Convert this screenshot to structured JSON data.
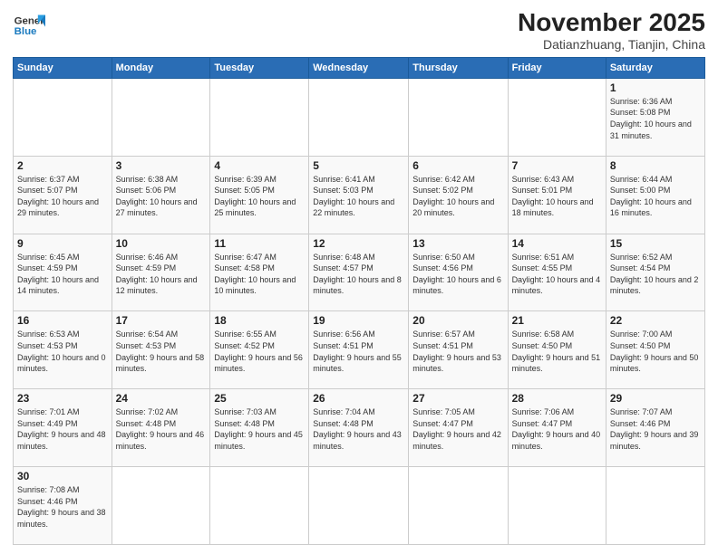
{
  "logo": {
    "line1": "General",
    "line2": "Blue"
  },
  "title": "November 2025",
  "subtitle": "Datianzhuang, Tianjin, China",
  "days_of_week": [
    "Sunday",
    "Monday",
    "Tuesday",
    "Wednesday",
    "Thursday",
    "Friday",
    "Saturday"
  ],
  "weeks": [
    [
      {
        "day": "",
        "info": ""
      },
      {
        "day": "",
        "info": ""
      },
      {
        "day": "",
        "info": ""
      },
      {
        "day": "",
        "info": ""
      },
      {
        "day": "",
        "info": ""
      },
      {
        "day": "",
        "info": ""
      },
      {
        "day": "1",
        "info": "Sunrise: 6:36 AM\nSunset: 5:08 PM\nDaylight: 10 hours and 31 minutes."
      }
    ],
    [
      {
        "day": "2",
        "info": "Sunrise: 6:37 AM\nSunset: 5:07 PM\nDaylight: 10 hours and 29 minutes."
      },
      {
        "day": "3",
        "info": "Sunrise: 6:38 AM\nSunset: 5:06 PM\nDaylight: 10 hours and 27 minutes."
      },
      {
        "day": "4",
        "info": "Sunrise: 6:39 AM\nSunset: 5:05 PM\nDaylight: 10 hours and 25 minutes."
      },
      {
        "day": "5",
        "info": "Sunrise: 6:41 AM\nSunset: 5:03 PM\nDaylight: 10 hours and 22 minutes."
      },
      {
        "day": "6",
        "info": "Sunrise: 6:42 AM\nSunset: 5:02 PM\nDaylight: 10 hours and 20 minutes."
      },
      {
        "day": "7",
        "info": "Sunrise: 6:43 AM\nSunset: 5:01 PM\nDaylight: 10 hours and 18 minutes."
      },
      {
        "day": "8",
        "info": "Sunrise: 6:44 AM\nSunset: 5:00 PM\nDaylight: 10 hours and 16 minutes."
      }
    ],
    [
      {
        "day": "9",
        "info": "Sunrise: 6:45 AM\nSunset: 4:59 PM\nDaylight: 10 hours and 14 minutes."
      },
      {
        "day": "10",
        "info": "Sunrise: 6:46 AM\nSunset: 4:59 PM\nDaylight: 10 hours and 12 minutes."
      },
      {
        "day": "11",
        "info": "Sunrise: 6:47 AM\nSunset: 4:58 PM\nDaylight: 10 hours and 10 minutes."
      },
      {
        "day": "12",
        "info": "Sunrise: 6:48 AM\nSunset: 4:57 PM\nDaylight: 10 hours and 8 minutes."
      },
      {
        "day": "13",
        "info": "Sunrise: 6:50 AM\nSunset: 4:56 PM\nDaylight: 10 hours and 6 minutes."
      },
      {
        "day": "14",
        "info": "Sunrise: 6:51 AM\nSunset: 4:55 PM\nDaylight: 10 hours and 4 minutes."
      },
      {
        "day": "15",
        "info": "Sunrise: 6:52 AM\nSunset: 4:54 PM\nDaylight: 10 hours and 2 minutes."
      }
    ],
    [
      {
        "day": "16",
        "info": "Sunrise: 6:53 AM\nSunset: 4:53 PM\nDaylight: 10 hours and 0 minutes."
      },
      {
        "day": "17",
        "info": "Sunrise: 6:54 AM\nSunset: 4:53 PM\nDaylight: 9 hours and 58 minutes."
      },
      {
        "day": "18",
        "info": "Sunrise: 6:55 AM\nSunset: 4:52 PM\nDaylight: 9 hours and 56 minutes."
      },
      {
        "day": "19",
        "info": "Sunrise: 6:56 AM\nSunset: 4:51 PM\nDaylight: 9 hours and 55 minutes."
      },
      {
        "day": "20",
        "info": "Sunrise: 6:57 AM\nSunset: 4:51 PM\nDaylight: 9 hours and 53 minutes."
      },
      {
        "day": "21",
        "info": "Sunrise: 6:58 AM\nSunset: 4:50 PM\nDaylight: 9 hours and 51 minutes."
      },
      {
        "day": "22",
        "info": "Sunrise: 7:00 AM\nSunset: 4:50 PM\nDaylight: 9 hours and 50 minutes."
      }
    ],
    [
      {
        "day": "23",
        "info": "Sunrise: 7:01 AM\nSunset: 4:49 PM\nDaylight: 9 hours and 48 minutes."
      },
      {
        "day": "24",
        "info": "Sunrise: 7:02 AM\nSunset: 4:48 PM\nDaylight: 9 hours and 46 minutes."
      },
      {
        "day": "25",
        "info": "Sunrise: 7:03 AM\nSunset: 4:48 PM\nDaylight: 9 hours and 45 minutes."
      },
      {
        "day": "26",
        "info": "Sunrise: 7:04 AM\nSunset: 4:48 PM\nDaylight: 9 hours and 43 minutes."
      },
      {
        "day": "27",
        "info": "Sunrise: 7:05 AM\nSunset: 4:47 PM\nDaylight: 9 hours and 42 minutes."
      },
      {
        "day": "28",
        "info": "Sunrise: 7:06 AM\nSunset: 4:47 PM\nDaylight: 9 hours and 40 minutes."
      },
      {
        "day": "29",
        "info": "Sunrise: 7:07 AM\nSunset: 4:46 PM\nDaylight: 9 hours and 39 minutes."
      }
    ],
    [
      {
        "day": "30",
        "info": "Sunrise: 7:08 AM\nSunset: 4:46 PM\nDaylight: 9 hours and 38 minutes."
      },
      {
        "day": "",
        "info": ""
      },
      {
        "day": "",
        "info": ""
      },
      {
        "day": "",
        "info": ""
      },
      {
        "day": "",
        "info": ""
      },
      {
        "day": "",
        "info": ""
      },
      {
        "day": "",
        "info": ""
      }
    ]
  ]
}
